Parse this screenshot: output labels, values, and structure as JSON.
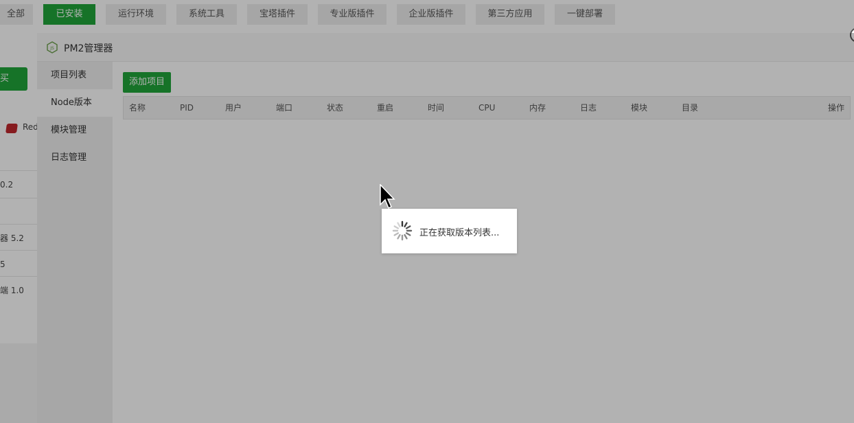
{
  "top_tabs": [
    {
      "label": "全部",
      "active": false
    },
    {
      "label": "已安装",
      "active": true
    },
    {
      "label": "运行环境",
      "active": false
    },
    {
      "label": "系统工具",
      "active": false
    },
    {
      "label": "宝塔插件",
      "active": false
    },
    {
      "label": "专业版插件",
      "active": false
    },
    {
      "label": "企业版插件",
      "active": false
    },
    {
      "label": "第三方应用",
      "active": false
    },
    {
      "label": "一键部署",
      "active": false
    }
  ],
  "background": {
    "buy_button": "买",
    "redis_label": "Red",
    "rows": [
      "0.2",
      "",
      "器 5.2",
      "5",
      "端 1.0"
    ]
  },
  "dialog": {
    "title": "PM2管理器",
    "logo_icon": "nodejs-icon",
    "sidebar": [
      {
        "label": "项目列表",
        "active": false
      },
      {
        "label": "Node版本",
        "active": true
      },
      {
        "label": "模块管理",
        "active": false
      },
      {
        "label": "日志管理",
        "active": false
      }
    ],
    "add_button": "添加项目",
    "table_headers": [
      "名称",
      "PID",
      "用户",
      "端口",
      "状态",
      "重启",
      "时间",
      "CPU",
      "内存",
      "日志",
      "模块",
      "目录",
      "操作"
    ]
  },
  "loading": {
    "text": "正在获取版本列表...",
    "icon": "spinner-icon"
  },
  "colors": {
    "accent": "#20a53a"
  }
}
